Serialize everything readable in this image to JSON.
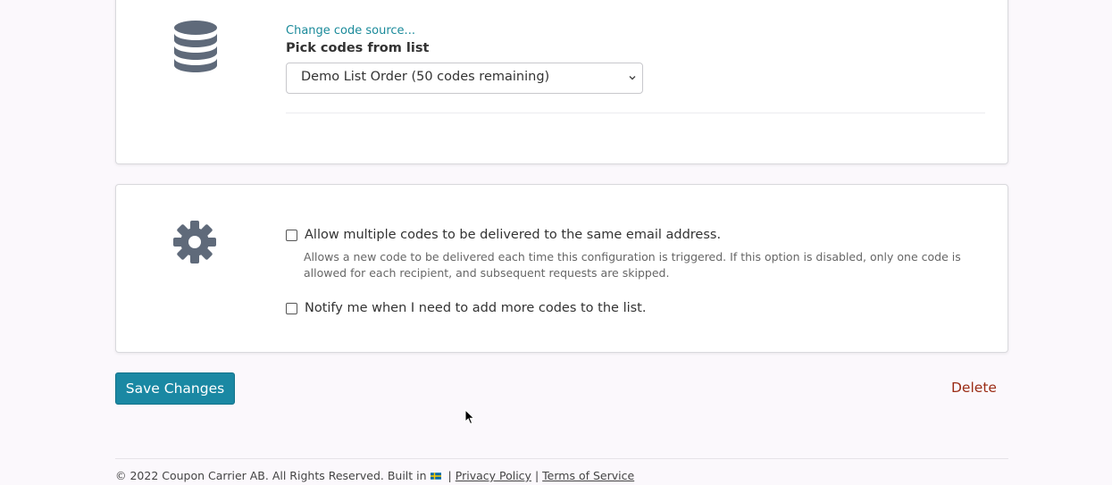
{
  "source_card": {
    "change_link": "Change code source...",
    "pick_label": "Pick codes from list",
    "selected_list": "Demo List Order (50 codes remaining)"
  },
  "options_card": {
    "allow_multiple": {
      "label": "Allow multiple codes to be delivered to the same email address.",
      "help": "Allows a new code to be delivered each time this configuration is triggered. If this option is disabled, only one code is allowed for each recipient, and subsequent requests are skipped.",
      "checked": false
    },
    "notify": {
      "label": "Notify me when I need to add more codes to the list.",
      "checked": false
    }
  },
  "actions": {
    "save_label": "Save Changes",
    "delete_label": "Delete"
  },
  "footer": {
    "copyright": "© 2022 Coupon Carrier AB. All Rights Reserved. Built in",
    "sep1": "|",
    "privacy": "Privacy Policy",
    "sep2": "|",
    "terms": "Terms of Service"
  },
  "colors": {
    "accent": "#1a88a3",
    "link": "#1a8a9a",
    "danger": "#9b2c15",
    "icon": "#5f6a7a"
  },
  "icons": {
    "source": "database-icon",
    "settings": "gear-icon",
    "flag": "sweden-flag-icon"
  }
}
